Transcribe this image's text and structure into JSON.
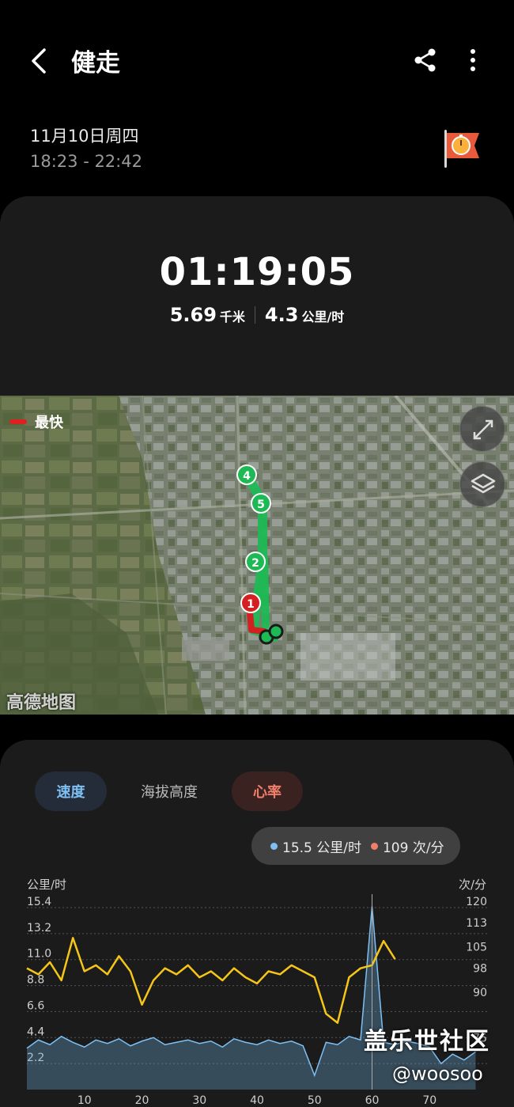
{
  "header": {
    "title": "健走"
  },
  "session": {
    "date": "11月10日周四",
    "time_range": "18:23 - 22:42"
  },
  "summary": {
    "duration": "01:19:05",
    "distance_value": "5.69",
    "distance_unit": "千米",
    "speed_value": "4.3",
    "speed_unit": "公里/时"
  },
  "map": {
    "legend_label": "最快",
    "provider": "高德地图",
    "markers": [
      "1",
      "2",
      "4",
      "5"
    ]
  },
  "tabs": {
    "speed": "速度",
    "altitude": "海拔高度",
    "heart_rate": "心率"
  },
  "tooltip": {
    "speed": "15.5 公里/时",
    "heart_rate": "109 次/分"
  },
  "chart_axes": {
    "left_title": "公里/时",
    "right_title": "次/分"
  },
  "chart_data": {
    "type": "line",
    "left_axis": {
      "unit": "公里/时",
      "ticks": [
        "15.4",
        "13.2",
        "11.0",
        "8.8",
        "6.6",
        "4.4",
        "2.2"
      ],
      "range": [
        0,
        15.4
      ]
    },
    "right_axis": {
      "unit": "次/分",
      "ticks": [
        "120",
        "113",
        "105",
        "98",
        "90",
        "75"
      ],
      "range": [
        60,
        120
      ]
    },
    "x_ticks": [
      "10",
      "20",
      "30",
      "40",
      "50",
      "60",
      "70"
    ],
    "x_range": [
      0,
      80
    ],
    "grid": true,
    "series": [
      {
        "name": "速度",
        "axis": "left",
        "x": [
          0,
          2,
          4,
          6,
          8,
          10,
          12,
          14,
          16,
          18,
          20,
          22,
          24,
          26,
          28,
          30,
          32,
          34,
          36,
          38,
          40,
          42,
          44,
          46,
          48,
          50,
          52,
          54,
          56,
          58,
          60,
          62,
          64,
          66,
          68,
          70,
          72,
          74,
          76,
          78
        ],
        "values": [
          3.5,
          4.2,
          3.8,
          4.5,
          4.0,
          3.6,
          4.2,
          3.9,
          4.3,
          3.7,
          4.1,
          4.4,
          3.8,
          4.0,
          4.2,
          3.9,
          4.1,
          3.6,
          4.3,
          4.0,
          3.8,
          4.2,
          3.9,
          4.1,
          3.7,
          1.2,
          4.0,
          3.8,
          4.5,
          4.2,
          15.5,
          4.0,
          3.8,
          4.1,
          3.9,
          3.6,
          2.2,
          3.0,
          2.5,
          3.2
        ]
      },
      {
        "name": "心率",
        "axis": "right",
        "x": [
          0,
          2,
          4,
          6,
          8,
          10,
          12,
          14,
          16,
          18,
          20,
          22,
          24,
          26,
          28,
          30,
          32,
          34,
          36,
          38,
          40,
          42,
          44,
          46,
          48,
          50,
          52,
          54,
          56,
          58,
          60,
          62,
          64
        ],
        "values": [
          100,
          98,
          102,
          96,
          110,
          99,
          101,
          98,
          104,
          99,
          88,
          96,
          100,
          98,
          101,
          97,
          99,
          96,
          100,
          97,
          95,
          99,
          98,
          101,
          99,
          97,
          85,
          82,
          97,
          100,
          101,
          109,
          103
        ]
      }
    ]
  },
  "overlay": {
    "brand": "盖乐世社区",
    "handle": "@woosoo"
  }
}
